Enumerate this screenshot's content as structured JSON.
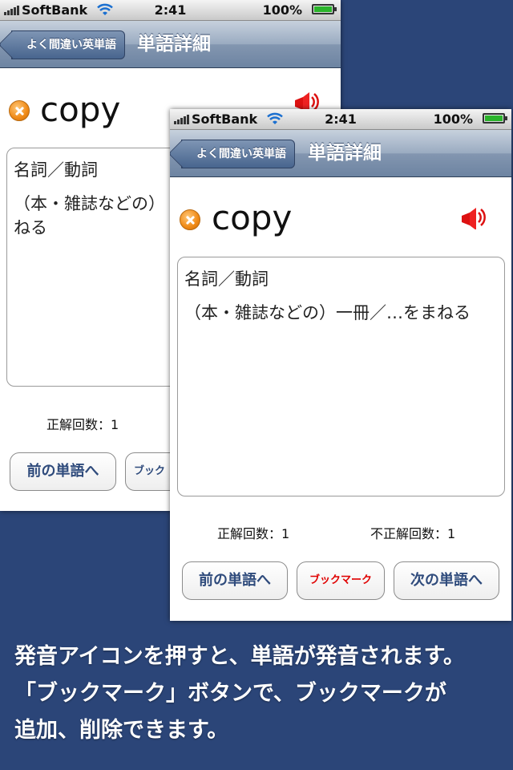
{
  "status_bar": {
    "carrier": "SoftBank",
    "time": "2:41",
    "battery": "100%"
  },
  "nav": {
    "back_label": "よく間違い英単語",
    "title": "単語詳細"
  },
  "word": "copy",
  "meaning": {
    "part_of_speech": "名詞／動詞",
    "definition": "（本・雑誌などの）一冊／…をまねる",
    "definition_back_line1": "（本・雑誌などの）",
    "definition_back_line2": "ねる"
  },
  "counts": {
    "correct": "正解回数：1",
    "incorrect": "不正解回数：1"
  },
  "buttons": {
    "prev": "前の単語へ",
    "bookmark": "ブックマーク",
    "bookmark_partial": "ブック",
    "next": "次の単語へ"
  },
  "caption": {
    "line1": "発音アイコンを押すと、単語が発音されます。",
    "line2": "「ブックマーク」ボタンで、ブックマークが",
    "line3": "追加、削除できます。"
  },
  "colors": {
    "background": "#2b4578",
    "bookmark_text": "#e00000",
    "button_text": "#2f4b7c"
  }
}
